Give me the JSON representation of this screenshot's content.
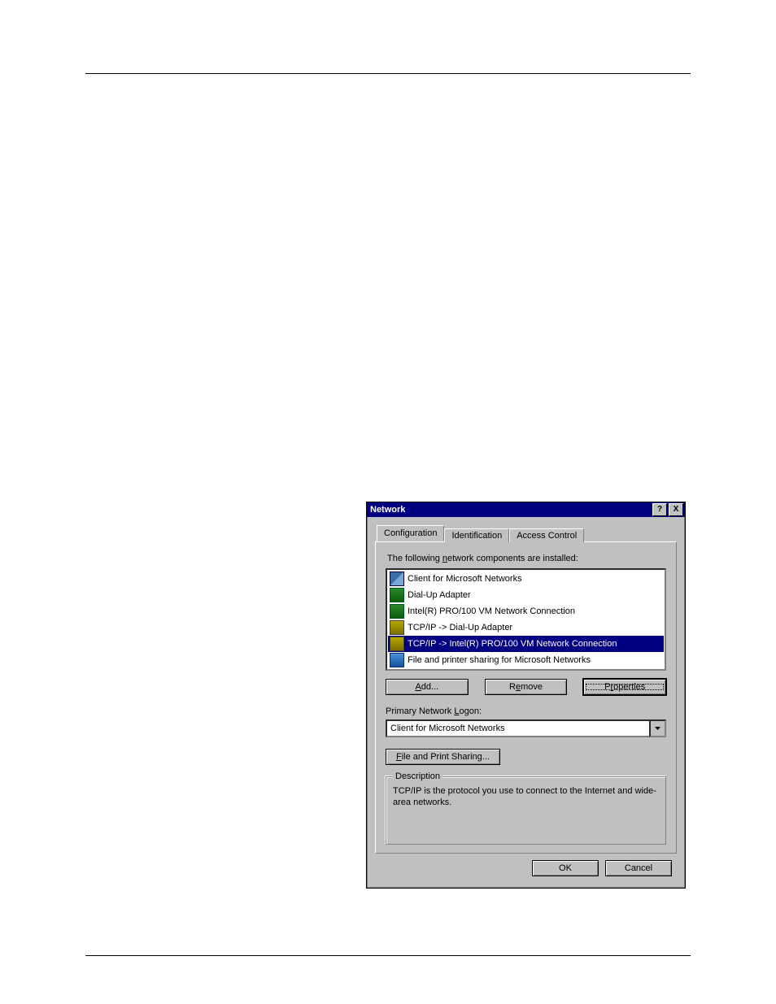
{
  "dialog": {
    "title": "Network",
    "help_label": "?",
    "close_label": "X",
    "tabs": [
      "Configuration",
      "Identification",
      "Access Control"
    ],
    "components_caption_pre": "The following ",
    "components_caption_u": "n",
    "components_caption_post": "etwork components are installed:",
    "items": [
      {
        "icon": "client",
        "label": "Client for Microsoft Networks"
      },
      {
        "icon": "adapter",
        "label": "Dial-Up Adapter"
      },
      {
        "icon": "adapter",
        "label": "Intel(R) PRO/100 VM Network Connection"
      },
      {
        "icon": "proto",
        "label": "TCP/IP -> Dial-Up Adapter"
      },
      {
        "icon": "proto",
        "label": "TCP/IP -> Intel(R) PRO/100 VM Network Connection",
        "selected": true
      },
      {
        "icon": "share",
        "label": "File and printer sharing for Microsoft Networks"
      }
    ],
    "add_u": "A",
    "add_post": "dd...",
    "remove_pre": "R",
    "remove_u": "e",
    "remove_post": "move",
    "properties_pre": "P",
    "properties_u": "r",
    "properties_post": "operties",
    "logon_pre": "Primary Network ",
    "logon_u": "L",
    "logon_post": "ogon:",
    "logon_value": "Client for Microsoft Networks",
    "sharing_u": "F",
    "sharing_post": "ile and Print Sharing...",
    "desc_legend": "Description",
    "desc_text": "TCP/IP is the protocol you use to connect to the Internet and wide-area networks.",
    "ok": "OK",
    "cancel": "Cancel"
  }
}
